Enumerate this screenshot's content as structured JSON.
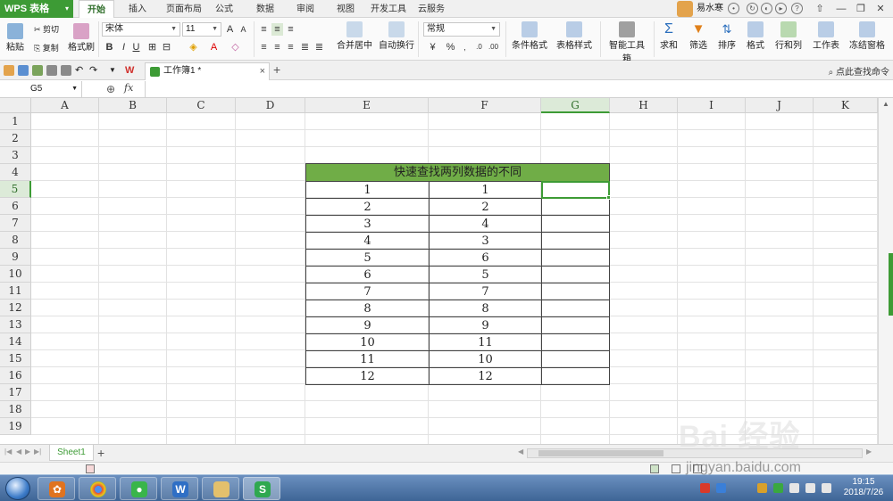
{
  "app": {
    "title": "WPS 表格"
  },
  "ribbon_tabs": [
    "开始",
    "插入",
    "页面布局",
    "公式",
    "数据",
    "审阅",
    "视图",
    "开发工具",
    "云服务"
  ],
  "user": {
    "name": "易水寒"
  },
  "ribbon": {
    "paste": "粘贴",
    "cut": "剪切",
    "copy": "复制",
    "format_painter": "格式刷",
    "font_name": "宋体",
    "font_size": "11",
    "merge_center": "合并居中",
    "wrap_text": "自动换行",
    "number_format": "常规",
    "conditional_format": "条件格式",
    "table_style": "表格样式",
    "smart_toolbox": "智能工具箱",
    "sum": "求和",
    "filter": "筛选",
    "sort": "排序",
    "format": "格式",
    "row_col": "行和列",
    "worksheet": "工作表",
    "freeze": "冻结窗格",
    "bold": "B",
    "italic": "I",
    "underline": "U",
    "percent": "%"
  },
  "document_tab": {
    "name": "工作簿1 *"
  },
  "search_command": "点此查找命令",
  "formula_bar": {
    "cell_ref": "G5",
    "fx": "fx",
    "value": ""
  },
  "columns": [
    "A",
    "B",
    "C",
    "D",
    "E",
    "F",
    "G",
    "H",
    "I",
    "J",
    "K"
  ],
  "rows": [
    "1",
    "2",
    "3",
    "4",
    "5",
    "6",
    "7",
    "8",
    "9",
    "10",
    "11",
    "12",
    "13",
    "14",
    "15",
    "16",
    "17",
    "18",
    "19"
  ],
  "selected_column": "G",
  "selected_row": "5",
  "table": {
    "title": "快速查找两列数据的不同",
    "title_color": "#70ad47",
    "col_e": [
      "1",
      "2",
      "3",
      "4",
      "5",
      "6",
      "7",
      "8",
      "9",
      "10",
      "11",
      "12"
    ],
    "col_f": [
      "1",
      "2",
      "4",
      "3",
      "6",
      "5",
      "7",
      "8",
      "9",
      "11",
      "10",
      "12"
    ]
  },
  "sheet_tabs": [
    "Sheet1"
  ],
  "taskbar": {
    "time": "19:15",
    "date": "2018/7/26"
  },
  "watermark": {
    "logo": "Bai 经验",
    "url": "jingyan.baidu.com"
  },
  "colors": {
    "accent": "#3d9b35",
    "header_fill": "#70ad47"
  }
}
